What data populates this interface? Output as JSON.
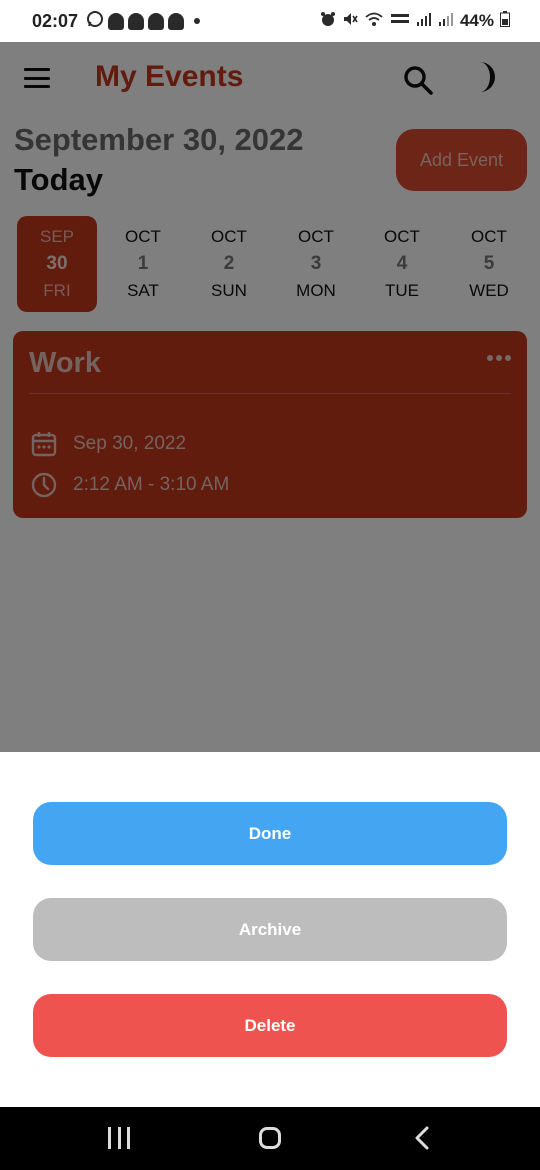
{
  "status": {
    "time": "02:07",
    "battery": "44%"
  },
  "header": {
    "title": "My Events",
    "icons": [
      "menu-icon",
      "search-icon",
      "dark-mode-moon-icon"
    ]
  },
  "date": {
    "full": "September 30, 2022",
    "relative": "Today"
  },
  "add_event_label": "Add Event",
  "days": [
    {
      "month": "SEP",
      "day": "30",
      "weekday": "FRI",
      "selected": true
    },
    {
      "month": "OCT",
      "day": "1",
      "weekday": "SAT",
      "selected": false
    },
    {
      "month": "OCT",
      "day": "2",
      "weekday": "SUN",
      "selected": false
    },
    {
      "month": "OCT",
      "day": "3",
      "weekday": "MON",
      "selected": false
    },
    {
      "month": "OCT",
      "day": "4",
      "weekday": "TUE",
      "selected": false
    },
    {
      "month": "OCT",
      "day": "5",
      "weekday": "WED",
      "selected": false
    }
  ],
  "event": {
    "title": "Work",
    "date": "Sep 30, 2022",
    "time": "2:12 AM - 3:10 AM"
  },
  "sheet": {
    "done_label": "Done",
    "archive_label": "Archive",
    "delete_label": "Delete"
  },
  "colors": {
    "accent": "#c2381c",
    "done": "#44a6f3",
    "archive": "#bdbdbd",
    "delete": "#ef5350"
  }
}
